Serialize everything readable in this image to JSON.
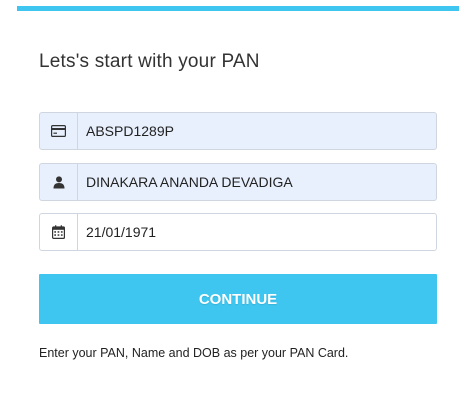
{
  "form": {
    "title": "Lets's start with your PAN",
    "fields": [
      {
        "icon": "credit-card-icon",
        "value": "ABSPD1289P"
      },
      {
        "icon": "user-icon",
        "value": "DINAKARA ANANDA DEVADIGA"
      },
      {
        "icon": "calendar-icon",
        "value": "21/01/1971"
      }
    ],
    "continue_label": "CONTINUE",
    "hint": "Enter your PAN, Name and DOB as per your PAN Card."
  },
  "colors": {
    "accent": "#3ec6f0",
    "autofill_bg": "#e8f0fe",
    "border": "#cfd6df",
    "text": "#333333"
  }
}
